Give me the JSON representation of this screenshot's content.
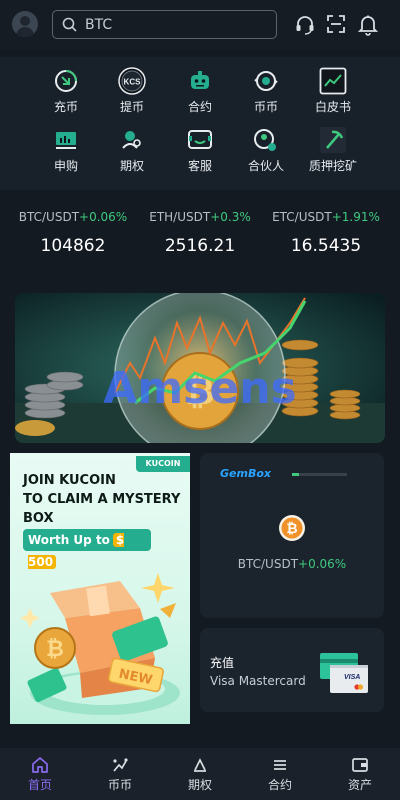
{
  "header": {
    "search_placeholder": "BTC",
    "icons": [
      "avatar",
      "search-icon",
      "headset-icon",
      "scan-icon",
      "bell-icon"
    ]
  },
  "menu": {
    "items": [
      {
        "label": "充币",
        "icon": "deposit-icon"
      },
      {
        "label": "提币",
        "icon": "kcs-icon"
      },
      {
        "label": "合约",
        "icon": "robot-icon"
      },
      {
        "label": "币币",
        "icon": "exchange-icon"
      },
      {
        "label": "白皮书",
        "icon": "chart-icon"
      },
      {
        "label": "申购",
        "icon": "subscribe-icon"
      },
      {
        "label": "期权",
        "icon": "options-icon"
      },
      {
        "label": "客服",
        "icon": "service-icon"
      },
      {
        "label": "合伙人",
        "icon": "partner-icon"
      },
      {
        "label": "质押挖矿",
        "icon": "pickaxe-icon"
      }
    ]
  },
  "tickers": [
    {
      "pair": "BTC/USDT",
      "change": "+0.06%",
      "price": "104862"
    },
    {
      "pair": "ETH/USDT",
      "change": "+0.3%",
      "price": "2516.21"
    },
    {
      "pair": "ETC/USDT",
      "change": "+1.91%",
      "price": "16.5435"
    }
  ],
  "banner": {
    "watermark": "Amsens"
  },
  "promo": {
    "badge": "KUCOIN",
    "title": "JOIN KUCOIN\nTO CLAIM A MYSTERY\nBOX",
    "worth_label": "Worth Up to",
    "worth_amount": "$ 500",
    "gift_tag": "NEW"
  },
  "gem_card": {
    "logo": "GemBox",
    "progress": 0.12,
    "pair": "BTC/USDT",
    "change": "+0.06%"
  },
  "deposit_card": {
    "title": "充值",
    "subtitle": "Visa Mastercard",
    "card_text": "VISA"
  },
  "nav": {
    "items": [
      {
        "label": "首页",
        "icon": "home-icon",
        "active": true
      },
      {
        "label": "币币",
        "icon": "spot-icon",
        "active": false
      },
      {
        "label": "期权",
        "icon": "options-nav-icon",
        "active": false
      },
      {
        "label": "合约",
        "icon": "contract-icon",
        "active": false
      },
      {
        "label": "资产",
        "icon": "wallet-icon",
        "active": false
      }
    ]
  },
  "colors": {
    "background": "#141a22",
    "accent_green": "#3fc97e",
    "active_nav": "#8a6cf0",
    "promo_green": "#24ae8f"
  }
}
